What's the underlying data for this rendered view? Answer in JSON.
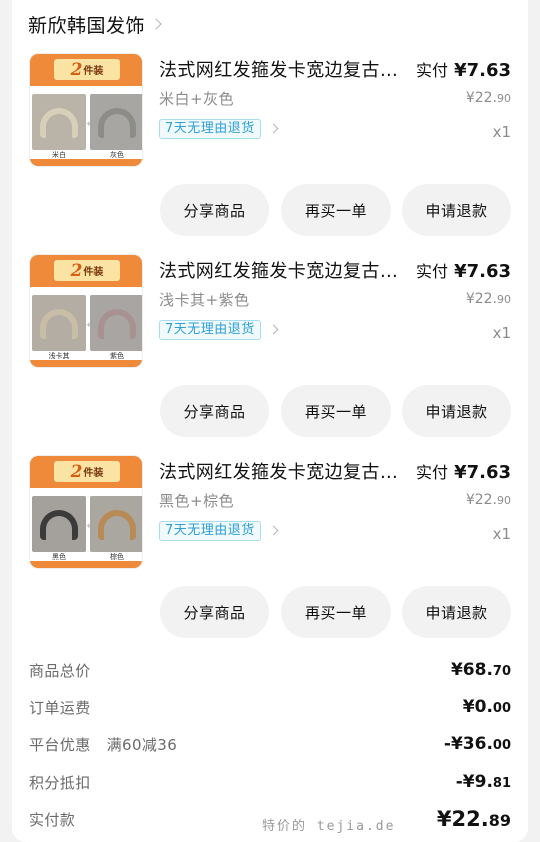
{
  "store": {
    "name": "新欣韩国发饰"
  },
  "items": [
    {
      "title": "法式网红发箍发卡宽边复古高颅顶头箍",
      "paid_label": "实付",
      "paid_amount": "¥7.63",
      "variant": "米白+灰色",
      "orig_price_main": "¥22.",
      "orig_price_dec": "90",
      "return_tag": "7天无理由退货",
      "qty": "x1",
      "thumb": {
        "badge_num": "2",
        "badge_txt": "件装",
        "cap_a": "米白",
        "cap_b": "灰色",
        "color_a": "#d8cfb9",
        "color_b": "#8d8d88",
        "bg_a": "#b9b3a8",
        "bg_b": "#a7a6a2"
      },
      "buttons": {
        "share": "分享商品",
        "rebuy": "再买一单",
        "refund": "申请退款"
      }
    },
    {
      "title": "法式网红发箍发卡宽边复古高颅顶头箍",
      "paid_label": "实付",
      "paid_amount": "¥7.63",
      "variant": "浅卡其+紫色",
      "orig_price_main": "¥22.",
      "orig_price_dec": "90",
      "return_tag": "7天无理由退货",
      "qty": "x1",
      "thumb": {
        "badge_num": "2",
        "badge_txt": "件装",
        "cap_a": "浅卡其",
        "cap_b": "紫色",
        "color_a": "#c9bda6",
        "color_b": "#a89191",
        "bg_a": "#b3ada3",
        "bg_b": "#a9a5a3"
      },
      "buttons": {
        "share": "分享商品",
        "rebuy": "再买一单",
        "refund": "申请退款"
      }
    },
    {
      "title": "法式网红发箍发卡宽边复古高颅顶头箍",
      "paid_label": "实付",
      "paid_amount": "¥7.63",
      "variant": "黑色+棕色",
      "orig_price_main": "¥22.",
      "orig_price_dec": "90",
      "return_tag": "7天无理由退货",
      "qty": "x1",
      "thumb": {
        "badge_num": "2",
        "badge_txt": "件装",
        "cap_a": "黑色",
        "cap_b": "棕色",
        "color_a": "#3b3b3b",
        "color_b": "#b88a55",
        "bg_a": "#a4a09b",
        "bg_b": "#aaa6a0"
      },
      "buttons": {
        "share": "分享商品",
        "rebuy": "再买一单",
        "refund": "申请退款"
      }
    }
  ],
  "summary": {
    "goods_total": {
      "label": "商品总价",
      "main": "¥68.",
      "dec": "70"
    },
    "shipping": {
      "label": "订单运费",
      "main": "¥0.",
      "dec": "00"
    },
    "platform_discount": {
      "label": "平台优惠",
      "promo": "满60减36",
      "main": "-¥36.",
      "dec": "00"
    },
    "points": {
      "label": "积分抵扣",
      "main": "-¥9.",
      "dec": "81"
    },
    "actual": {
      "label": "实付款",
      "main": "¥22.",
      "dec": "89"
    }
  },
  "watermark": "特价的 tejia.de",
  "colors": {
    "accent_orange": "#ef8a3a",
    "return_blue": "#2f9fd6"
  }
}
